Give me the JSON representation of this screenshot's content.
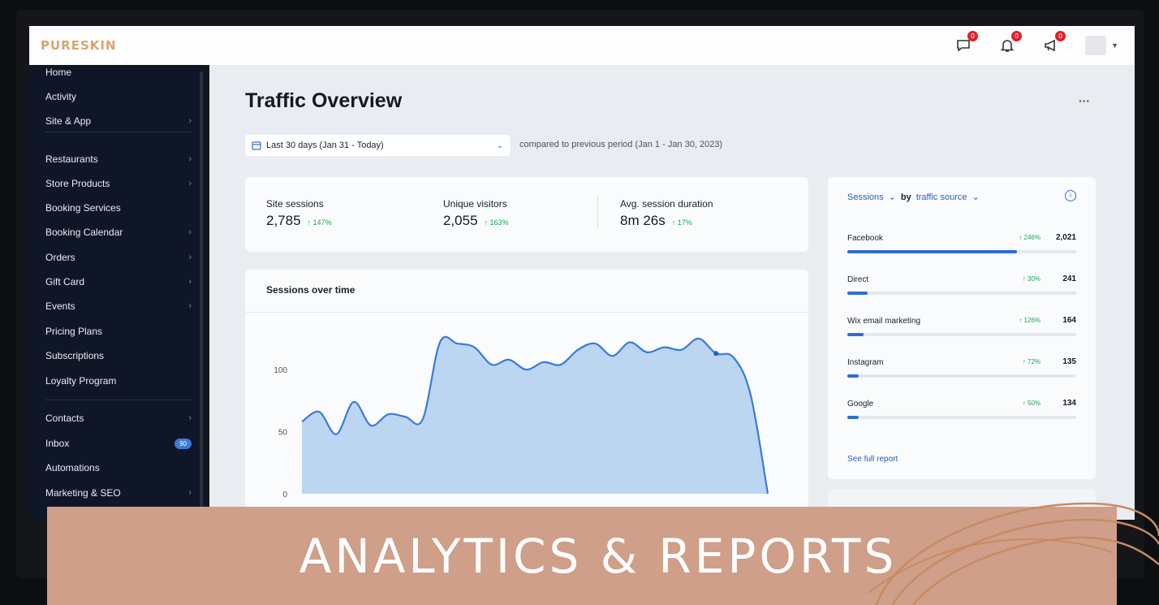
{
  "brand": {
    "logo": "PURESKIN",
    "accent": "#d8a66e"
  },
  "topbar": {
    "icons": [
      {
        "name": "chat-icon",
        "badge": "0"
      },
      {
        "name": "bell-icon",
        "badge": "0"
      },
      {
        "name": "megaphone-icon",
        "badge": "0"
      }
    ]
  },
  "sidebar": {
    "items": [
      {
        "label": "Home",
        "chevron": false
      },
      {
        "label": "Activity",
        "chevron": false
      },
      {
        "label": "Site & App",
        "chevron": true
      },
      {
        "label": "Restaurants",
        "chevron": true
      },
      {
        "label": "Store Products",
        "chevron": true
      },
      {
        "label": "Booking Services",
        "chevron": false
      },
      {
        "label": "Booking Calendar",
        "chevron": true
      },
      {
        "label": "Orders",
        "chevron": true
      },
      {
        "label": "Gift Card",
        "chevron": true
      },
      {
        "label": "Events",
        "chevron": true
      },
      {
        "label": "Pricing Plans",
        "chevron": false
      },
      {
        "label": "Subscriptions",
        "chevron": false
      },
      {
        "label": "Loyalty Program",
        "chevron": false
      },
      {
        "label": "Contacts",
        "chevron": true
      },
      {
        "label": "Inbox",
        "chevron": false,
        "badge": "90"
      },
      {
        "label": "Automations",
        "chevron": false
      },
      {
        "label": "Marketing & SEO",
        "chevron": true
      }
    ]
  },
  "main": {
    "title": "Traffic Overview",
    "more": "···",
    "date_range": "Last 30 days (Jan 31 - Today)",
    "compare_text": "compared to previous period (Jan 1 - Jan 30, 2023)",
    "kpis": [
      {
        "label": "Site sessions",
        "value": "2,785",
        "delta": "↑ 147%"
      },
      {
        "label": "Unique visitors",
        "value": "2,055",
        "delta": "↑ 163%"
      },
      {
        "label": "Avg. session duration",
        "value": "8m 26s",
        "delta": "↑ 17%"
      }
    ]
  },
  "chart_data": {
    "type": "area",
    "title": "Sessions over time",
    "ylim": [
      0,
      140
    ],
    "yticks": [
      "100",
      "50",
      "0"
    ],
    "x": [
      1,
      2,
      3,
      4,
      5,
      6,
      7,
      8,
      9,
      10,
      11,
      12,
      13,
      14,
      15,
      16,
      17,
      18,
      19,
      20,
      21,
      22,
      23,
      24,
      25,
      26,
      27,
      28,
      29,
      30,
      31
    ],
    "values": [
      58,
      66,
      48,
      74,
      55,
      64,
      62,
      60,
      122,
      121,
      118,
      104,
      108,
      100,
      106,
      104,
      116,
      121,
      111,
      122,
      114,
      118,
      116,
      125,
      113,
      110,
      80,
      0
    ]
  },
  "sources": {
    "metric": "Sessions",
    "by_label": "by",
    "by_value": "traffic source",
    "info": "i",
    "rows": [
      {
        "name": "Facebook",
        "delta": "↑ 246%",
        "count": "2,021",
        "fraction": 0.74
      },
      {
        "name": "Direct",
        "delta": "↑ 30%",
        "count": "241",
        "fraction": 0.09
      },
      {
        "name": "Wix email marketing",
        "delta": "↑ 126%",
        "count": "164",
        "fraction": 0.07
      },
      {
        "name": "Instagram",
        "delta": "↑ 72%",
        "count": "135",
        "fraction": 0.05
      },
      {
        "name": "Google",
        "delta": "↑ 50%",
        "count": "134",
        "fraction": 0.05
      }
    ],
    "link": "See full report"
  },
  "banner": {
    "text": "ANALYTICS & REPORTS",
    "color": "#cf9f89"
  }
}
